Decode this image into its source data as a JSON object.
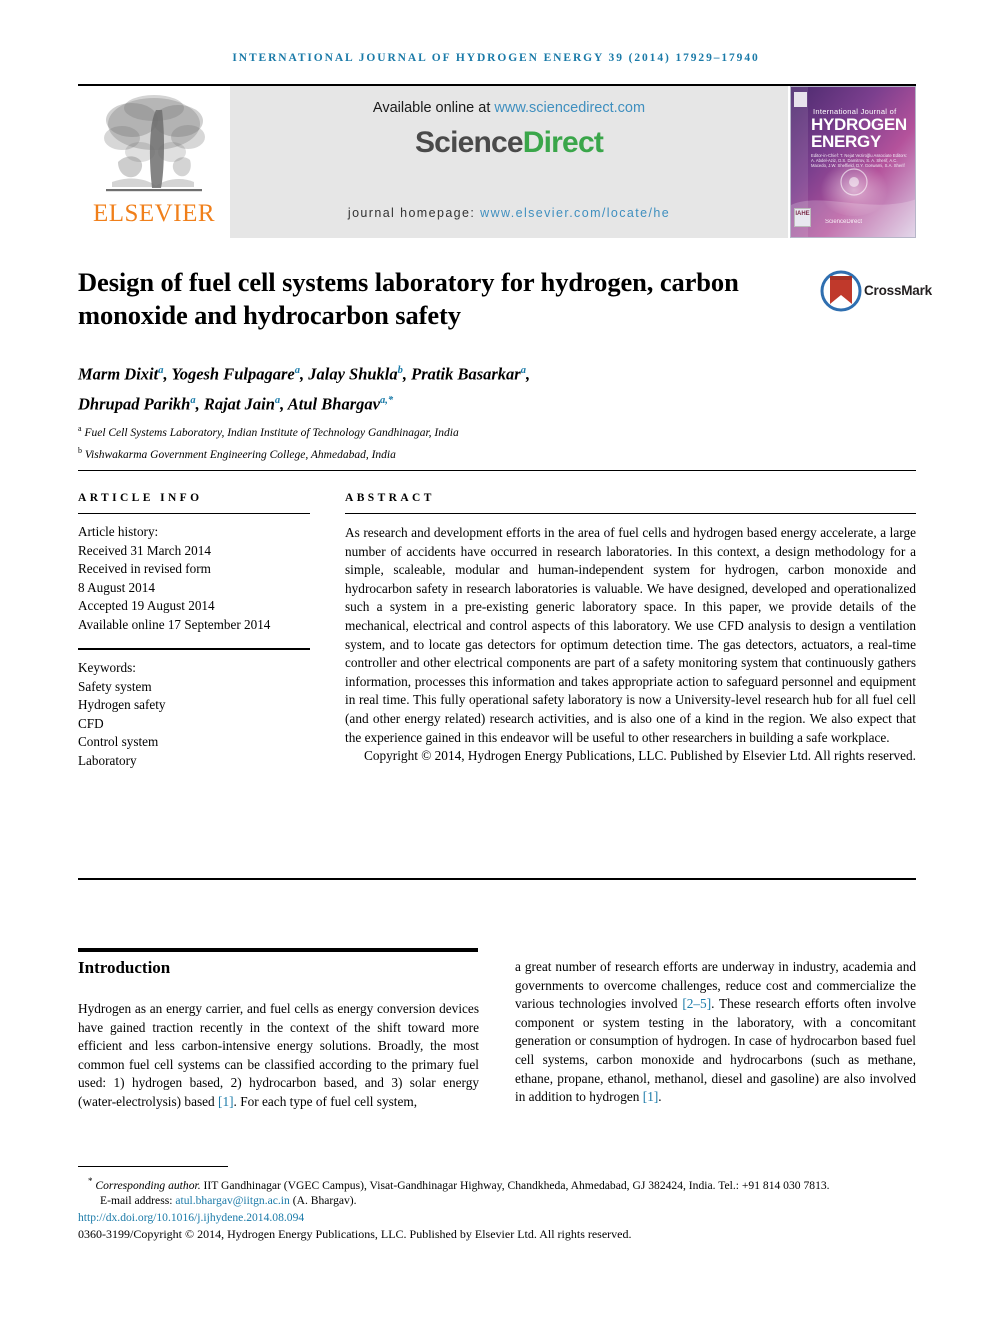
{
  "running_head": "International Journal of Hydrogen Energy 39 (2014) 17929–17940",
  "masthead": {
    "publisher_name": "ELSEVIER",
    "available_prefix": "Available online at ",
    "available_link": "www.sciencedirect.com",
    "logo_part1": "Science",
    "logo_part2": "Direct",
    "homepage_label": "journal homepage: ",
    "homepage_link": "www.elsevier.com/locate/he",
    "cover": {
      "line_small": "International Journal of",
      "line_big_1": "HYDROGEN",
      "line_big_2": "ENERGY",
      "editors": "Editor-in-Chief:  T. Nejat Veziroğlu\nAssociate Editors:  A. Abdel-Aziz, D.S. Damitrov, S. A. Sherif, A.C. Macedo, J.W. Sheffield, D.Y. Goswami, S.A. Sherif",
      "iahe_badge": "IAHE",
      "sciencedirect_footer": "ScienceDirect"
    }
  },
  "crossmark": {
    "label": "CrossMark"
  },
  "article": {
    "title": "Design of fuel cell systems laboratory for hydrogen, carbon monoxide and hydrocarbon safety",
    "authors_line_1_parts": [
      {
        "name": "Marm Dixit",
        "sup": "a",
        "sep": ", "
      },
      {
        "name": "Yogesh Fulpagare",
        "sup": "a",
        "sep": ", "
      },
      {
        "name": "Jalay Shukla",
        "sup": "b",
        "sep": ", "
      },
      {
        "name": "Pratik Basarkar",
        "sup": "a",
        "sep": ","
      }
    ],
    "authors_line_2_parts": [
      {
        "name": "Dhrupad Parikh",
        "sup": "a",
        "sep": ", "
      },
      {
        "name": "Rajat Jain",
        "sup": "a",
        "sep": ", "
      },
      {
        "name": "Atul Bhargav",
        "sup": "a,",
        "sup_star": "*",
        "sep": ""
      }
    ],
    "affiliations": [
      {
        "mark": "a",
        "text": "Fuel Cell Systems Laboratory, Indian Institute of Technology Gandhinagar, India"
      },
      {
        "mark": "b",
        "text": "Vishwakarma Government Engineering College, Ahmedabad, India"
      }
    ]
  },
  "article_info": {
    "heading": "Article info",
    "history_label": "Article history:",
    "history": [
      "Received 31 March 2014",
      "Received in revised form",
      "8 August 2014",
      "Accepted 19 August 2014",
      "Available online 17 September 2014"
    ],
    "keywords_label": "Keywords:",
    "keywords": [
      "Safety system",
      "Hydrogen safety",
      "CFD",
      "Control system",
      "Laboratory"
    ]
  },
  "abstract": {
    "heading": "Abstract",
    "text": "As research and development efforts in the area of fuel cells and hydrogen based energy accelerate, a large number of accidents have occurred in research laboratories. In this context, a design methodology for a simple, scaleable, modular and human-independent system for hydrogen, carbon monoxide and hydrocarbon safety in research laboratories is valuable. We have designed, developed and operationalized such a system in a pre-existing generic laboratory space. In this paper, we provide details of the mechanical, electrical and control aspects of this laboratory. We use CFD analysis to design a ventilation system, and to locate gas detectors for optimum detection time. The gas detectors, actuators, a real-time controller and other electrical components are part of a safety monitoring system that continuously gathers information, processes this information and takes appropriate action to safeguard personnel and equipment in real time. This fully operational safety laboratory is now a University-level research hub for all fuel cell (and other energy related) research activities, and is also one of a kind in the region. We also expect that the experience gained in this endeavor will be useful to other researchers in building a safe workplace.",
    "copyright": "Copyright © 2014, Hydrogen Energy Publications, LLC. Published by Elsevier Ltd. All rights reserved."
  },
  "body": {
    "section_title": "Introduction",
    "left_pre": "Hydrogen as an energy carrier, and fuel cells as energy conversion devices have gained traction recently in the context of the shift toward more efficient and less carbon-intensive energy solutions. Broadly, the most common fuel cell systems can be classified according to the primary fuel used: 1) hydrogen based, 2) hydrocarbon based, and 3) solar energy (water-electrolysis) based ",
    "left_cite": "[1]",
    "left_post": ". For each type of fuel cell system,",
    "right_pre": "a great number of research efforts are underway in industry, academia and governments to overcome challenges, reduce cost and commercialize the various technologies involved ",
    "right_cite_1": "[2–5]",
    "right_mid": ". These research efforts often involve component or system testing in the laboratory, with a concomitant generation or consumption of hydrogen. In case of hydrocarbon based fuel cell systems, carbon monoxide and hydrocarbons (such as methane, ethane, propane, ethanol, methanol, diesel and gasoline) are also involved in addition to hydrogen ",
    "right_cite_2": "[1]",
    "right_post": "."
  },
  "footnotes": {
    "corresponding_star": "*",
    "corresponding_label": "Corresponding author.",
    "corresponding_address": " IIT Gandhinagar (VGEC Campus), Visat-Gandhinagar Highway, Chandkheda, Ahmedabad, GJ 382424, India. Tel.: +91 814 030 7813.",
    "email_label": "E-mail address: ",
    "email_link": "atul.bhargav@iitgn.ac.in",
    "email_suffix": " (A. Bhargav).",
    "doi": "http://dx.doi.org/10.1016/j.ijhydene.2014.08.094",
    "issn_line": "0360-3199/Copyright © 2014, Hydrogen Energy Publications, LLC. Published by Elsevier Ltd. All rights reserved."
  },
  "colors": {
    "link_blue": "#1a7aa8",
    "sciencedirect_green": "#3aa64a",
    "elsevier_orange": "#f07f1a"
  }
}
